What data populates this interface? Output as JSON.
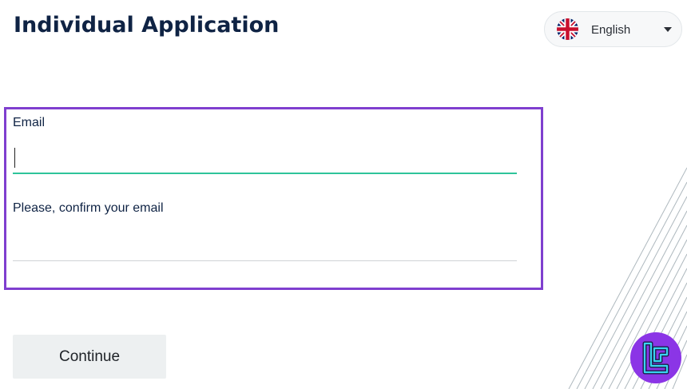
{
  "header": {
    "title": "Individual Application"
  },
  "language": {
    "selected": "English",
    "flag_icon": "uk-flag-icon",
    "chevron_icon": "chevron-down-icon"
  },
  "form": {
    "email_label": "Email",
    "email_value": "",
    "confirm_label": "Please, confirm your email",
    "confirm_value": "",
    "continue_label": "Continue"
  },
  "colors": {
    "title": "#0f2344",
    "highlight_border": "#7f3fcf",
    "focus_underline": "#2ec49a",
    "button_bg": "#edf0f1",
    "logo_bg": "#8b35e6"
  },
  "logo": {
    "icon": "brand-logo-icon"
  }
}
